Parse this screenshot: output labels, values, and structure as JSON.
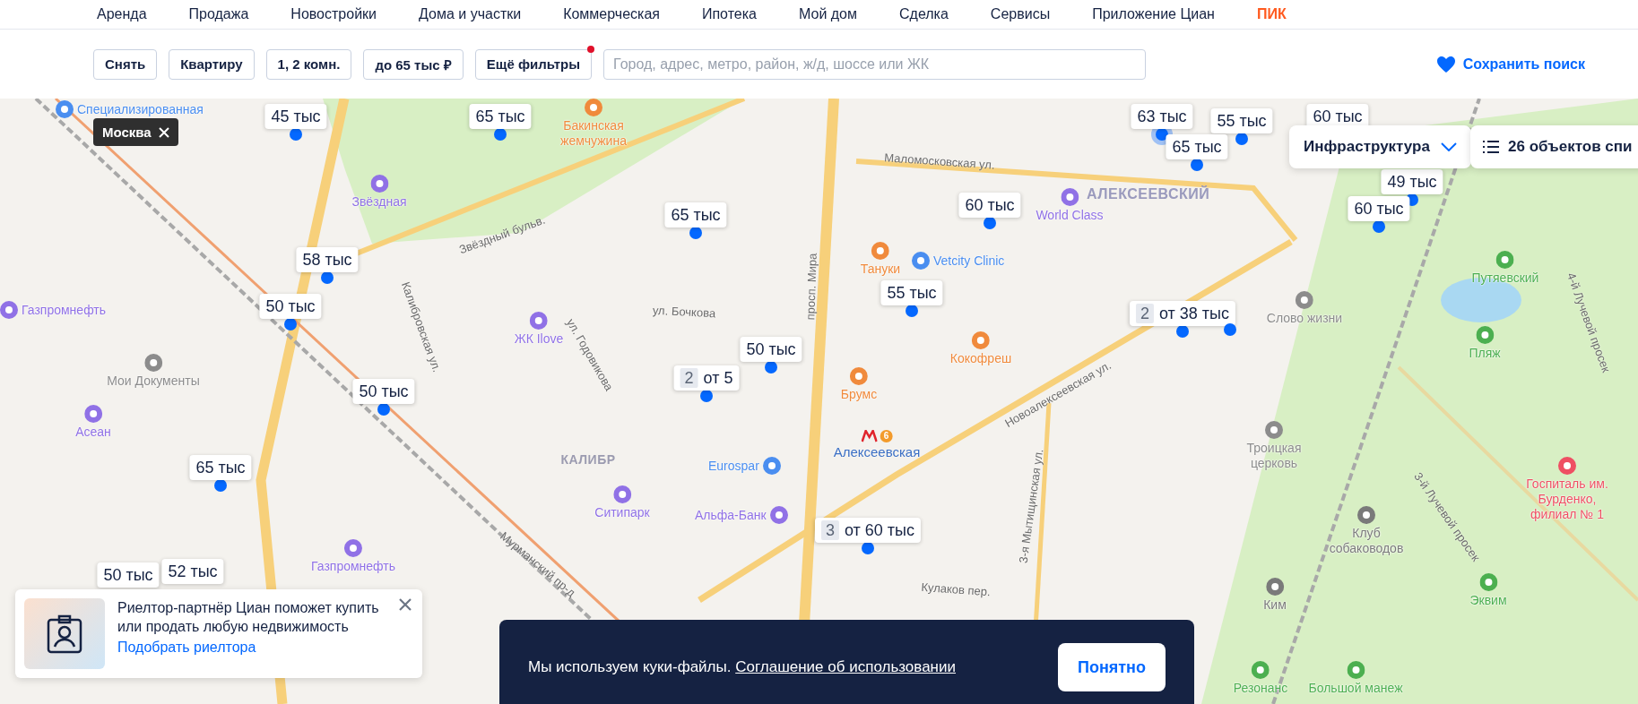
{
  "nav": [
    {
      "label": "Аренда",
      "kind": "link"
    },
    {
      "label": "Продажа",
      "kind": "link"
    },
    {
      "label": "Новостройки",
      "kind": "link"
    },
    {
      "label": "Дома и участки",
      "kind": "link"
    },
    {
      "label": "Коммерческая",
      "kind": "link"
    },
    {
      "label": "Ипотека",
      "kind": "link"
    },
    {
      "label": "Мой дом",
      "kind": "link"
    },
    {
      "label": "Сделка",
      "kind": "link"
    },
    {
      "label": "Сервисы",
      "kind": "link"
    },
    {
      "label": "Приложение Циан",
      "kind": "link"
    },
    {
      "label": "ПИК",
      "kind": "brand"
    }
  ],
  "filters": {
    "buttons": [
      {
        "label": "Снять",
        "has_notice": false
      },
      {
        "label": "Квартиру",
        "has_notice": false
      },
      {
        "label": "1, 2 комн.",
        "has_notice": false
      },
      {
        "label": "до 65 тыс ₽",
        "has_notice": false
      },
      {
        "label": "Ещё фильтры",
        "has_notice": true
      }
    ],
    "search": {
      "placeholder": "Город, адрес, метро, район, ж/д, шоссе или ЖК"
    },
    "save_search": "Сохранить поиск"
  },
  "map": {
    "region_chip": {
      "label": "Москва"
    },
    "infrastructure": {
      "label": "Инфраструктура"
    },
    "list_button": {
      "label": "26 объектов спи"
    },
    "labels": [
      {
        "kind": "poi",
        "text": "Специализированная",
        "color": "#4a8ef0"
      },
      {
        "kind": "poi",
        "text": "Бакинская жемчужина",
        "color": "#f08a3c"
      },
      {
        "kind": "poi",
        "text": "Звёздная",
        "color": "#9071e6"
      },
      {
        "kind": "road",
        "text": "Звёздный бульв."
      },
      {
        "kind": "road",
        "text": "Маломосковская ул."
      },
      {
        "kind": "district",
        "text": "АЛЕКСЕЕВСКИЙ"
      },
      {
        "kind": "poi",
        "text": "World Class",
        "color": "#9071e6"
      },
      {
        "kind": "poi",
        "text": "Vetcity Clinic",
        "color": "#4a8ef0"
      },
      {
        "kind": "poi",
        "text": "Тануки",
        "color": "#f08a3c"
      },
      {
        "kind": "poi",
        "text": "Газпромнефть",
        "color": "#9071e6"
      },
      {
        "kind": "poi",
        "text": "ЖК Ilove",
        "color": "#9071e6"
      },
      {
        "kind": "road",
        "text": "ул. Бочкова"
      },
      {
        "kind": "road",
        "text": "ул. Годовикова"
      },
      {
        "kind": "road",
        "text": "Калибровская ул."
      },
      {
        "kind": "poi",
        "text": "Мои Документы",
        "color": "#8c8c8c"
      },
      {
        "kind": "poi",
        "text": "Асеан",
        "color": "#9071e6"
      },
      {
        "kind": "road",
        "text": "просп. Мира"
      },
      {
        "kind": "poi",
        "text": "Кокофреш",
        "color": "#f08a3c"
      },
      {
        "kind": "poi",
        "text": "Брумс",
        "color": "#f08a3c"
      },
      {
        "kind": "metro",
        "text": "Алексеевская",
        "line": "6"
      },
      {
        "kind": "road",
        "text": "Новоалексеевская ул."
      },
      {
        "kind": "poi",
        "text": "Слово жизни",
        "color": "#8c8c8c"
      },
      {
        "kind": "poi",
        "text": "Путяевский",
        "color": "#4caf50"
      },
      {
        "kind": "poi",
        "text": "Пляж",
        "color": "#4caf50"
      },
      {
        "kind": "road",
        "text": "4-й Лучевой просек"
      },
      {
        "kind": "district",
        "text": "КАЛИБР"
      },
      {
        "kind": "poi",
        "text": "Eurospar",
        "color": "#4a8ef0"
      },
      {
        "kind": "poi",
        "text": "Троицкая церковь",
        "color": "#8c8c8c"
      },
      {
        "kind": "poi",
        "text": "Ситипарк",
        "color": "#9071e6"
      },
      {
        "kind": "poi",
        "text": "Альфа-Банк",
        "color": "#9071e6"
      },
      {
        "kind": "road",
        "text": "Мурманский пр-д"
      },
      {
        "kind": "poi",
        "text": "Газпромнефть",
        "color": "#9071e6"
      },
      {
        "kind": "road",
        "text": "3-я Мытищинская ул."
      },
      {
        "kind": "road",
        "text": "Кулаков пер."
      },
      {
        "kind": "poi",
        "text": "Госпиталь им. Бурденко, филиал № 1",
        "color": "#ef4f63"
      },
      {
        "kind": "poi",
        "text": "Клуб собаководов",
        "color": "#7a7a7a"
      },
      {
        "kind": "road",
        "text": "3-й Лучевой просек"
      },
      {
        "kind": "poi",
        "text": "Ким",
        "color": "#7a7a7a"
      },
      {
        "kind": "poi",
        "text": "Эквим",
        "color": "#4caf50"
      },
      {
        "kind": "poi",
        "text": "Резонанс",
        "color": "#4caf50"
      },
      {
        "kind": "poi",
        "text": "Большой манеж",
        "color": "#4caf50"
      }
    ],
    "pins": [
      {
        "kind": "single",
        "price": "45 тыс",
        "highlighted": false
      },
      {
        "kind": "single",
        "price": "65 тыс",
        "highlighted": false
      },
      {
        "kind": "single",
        "price": "63 тыс",
        "highlighted": true
      },
      {
        "kind": "single",
        "price": "55 тыс",
        "highlighted": false
      },
      {
        "kind": "tag-only",
        "price": "60 тыс",
        "highlighted": false
      },
      {
        "kind": "single",
        "price": "65 тыс",
        "highlighted": false
      },
      {
        "kind": "single",
        "price": "49 тыс",
        "highlighted": false
      },
      {
        "kind": "single",
        "price": "60 тыс",
        "highlighted": false
      },
      {
        "kind": "single",
        "price": "65 тыс",
        "highlighted": false
      },
      {
        "kind": "single",
        "price": "60 тыс",
        "highlighted": false
      },
      {
        "kind": "single",
        "price": "58 тыс",
        "highlighted": false
      },
      {
        "kind": "single",
        "price": "50 тыс",
        "highlighted": false
      },
      {
        "kind": "single",
        "price": "55 тыс",
        "highlighted": false
      },
      {
        "kind": "cluster",
        "count": "2",
        "price": "от 38 тыс",
        "highlighted": false
      },
      {
        "kind": "dot",
        "highlighted": false
      },
      {
        "kind": "single",
        "price": "50 тыс",
        "highlighted": false
      },
      {
        "kind": "cluster",
        "count": "2",
        "price": "от 5",
        "highlighted": false
      },
      {
        "kind": "single",
        "price": "50 тыс",
        "highlighted": false
      },
      {
        "kind": "single",
        "price": "65 тыс",
        "highlighted": false
      },
      {
        "kind": "cluster",
        "count": "3",
        "price": "от 60 тыс",
        "highlighted": false
      },
      {
        "kind": "tag-only",
        "price": "50 тыс",
        "highlighted": false
      },
      {
        "kind": "tag-only",
        "price": "52 тыс",
        "highlighted": false
      }
    ]
  },
  "realtor_promo": {
    "text": "Риелтор-партнёр Циан поможет купить или продать любую недвижимость",
    "link": "Подобрать риелтора"
  },
  "cookie_banner": {
    "text": "Мы используем куки-файлы.",
    "link": "Соглашение об использовании",
    "button": "Понятно"
  }
}
